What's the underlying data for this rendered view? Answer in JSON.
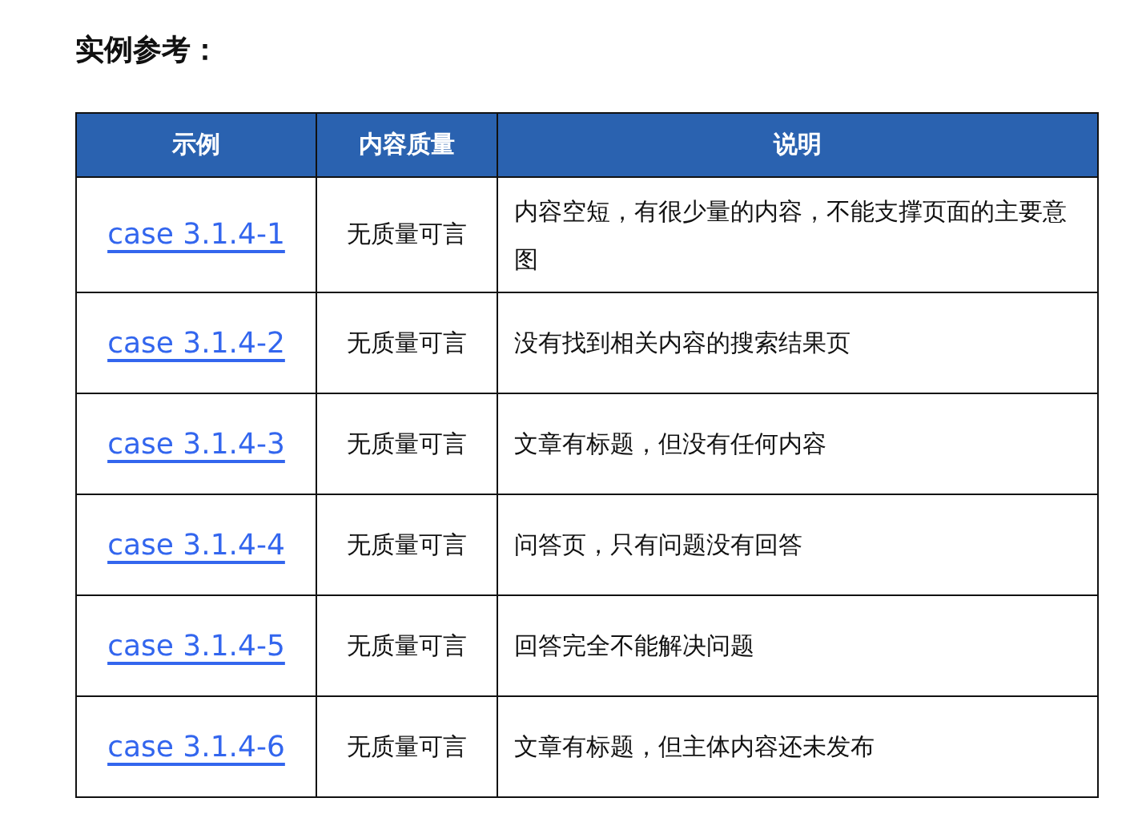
{
  "title": "实例参考：",
  "table": {
    "columns": [
      "示例",
      "内容质量",
      "说明"
    ],
    "rows": [
      {
        "example": "case 3.1.4-1",
        "quality": "无质量可言",
        "description": "内容空短，有很少量的内容，不能支撑页面的主要意图"
      },
      {
        "example": "case 3.1.4-2",
        "quality": "无质量可言",
        "description": "没有找到相关内容的搜索结果页"
      },
      {
        "example": "case 3.1.4-3",
        "quality": "无质量可言",
        "description": "文章有标题，但没有任何内容"
      },
      {
        "example": "case 3.1.4-4",
        "quality": "无质量可言",
        "description": "问答页，只有问题没有回答"
      },
      {
        "example": "case 3.1.4-5",
        "quality": "无质量可言",
        "description": "回答完全不能解决问题"
      },
      {
        "example": "case 3.1.4-6",
        "quality": "无质量可言",
        "description": "文章有标题，但主体内容还未发布"
      }
    ]
  }
}
